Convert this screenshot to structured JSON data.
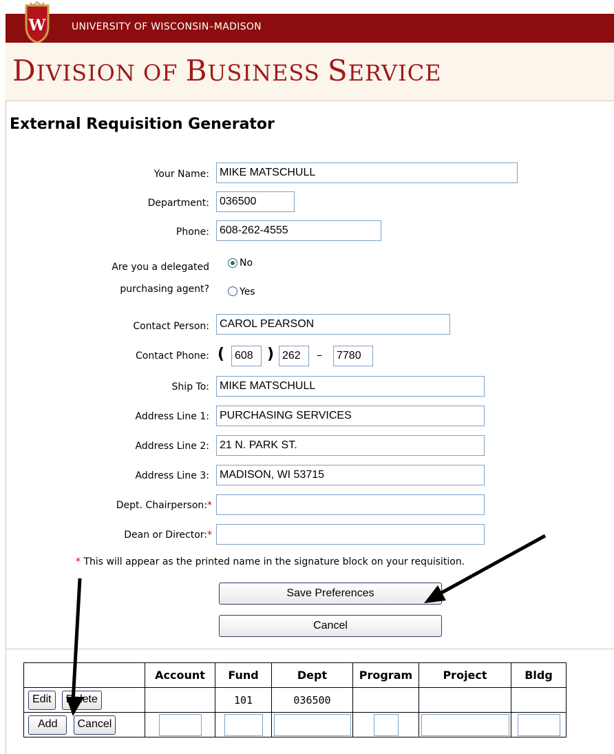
{
  "header": {
    "university": "UNIVERSITY OF WISCONSIN–MADISON",
    "division_first": "D",
    "division_rest": "IVISION OF ",
    "division_b": "B",
    "division_usiness": "USINESS ",
    "division_s": "S",
    "division_ervice": "ERVICE",
    "crest_letter": "W",
    "bar_color": "#8c0d0d",
    "title_color": "#a01919"
  },
  "page": {
    "title": "External Requisition Generator"
  },
  "form": {
    "your_name_label": "Your Name:",
    "your_name_value": "MIKE MATSCHULL",
    "department_label": "Department:",
    "department_value": "036500",
    "phone_label": "Phone:",
    "phone_value": "608-262-4555",
    "delegated_label_1": "Are you a delegated",
    "delegated_label_2": "purchasing agent?",
    "delegated_no": "No",
    "delegated_yes": "Yes",
    "delegated_selected": "No",
    "contact_person_label": "Contact Person:",
    "contact_person_value": "CAROL PEARSON",
    "contact_phone_label": "Contact Phone:",
    "contact_phone_open": "(",
    "contact_phone_close": ")",
    "contact_phone_dash": "–",
    "contact_phone_area": "608",
    "contact_phone_prefix": "262",
    "contact_phone_line": "7780",
    "ship_to_label": "Ship To:",
    "ship_to_value": "MIKE MATSCHULL",
    "address1_label": "Address Line 1:",
    "address1_value": "PURCHASING SERVICES",
    "address2_label": "Address Line 2:",
    "address2_value": "21 N. PARK ST.",
    "address3_label": "Address Line 3:",
    "address3_value": "MADISON, WI 53715",
    "chair_label": "Dept. Chairperson:",
    "chair_value": "",
    "dean_label": "Dean or Director:",
    "dean_value": "",
    "required_mark": "*",
    "note_text": " This will appear as the printed name in the signature block on your requisition.",
    "save_label": "Save Preferences",
    "cancel_label": "Cancel"
  },
  "funding_table": {
    "headers": [
      "",
      "Account",
      "Fund",
      "Dept",
      "Program",
      "Project",
      "Bldg"
    ],
    "row1": {
      "edit": "Edit",
      "delete": "Delete",
      "account": "",
      "fund": "101",
      "dept": "036500",
      "program": "",
      "project": "",
      "bldg": ""
    },
    "row2": {
      "add": "Add",
      "cancel": "Cancel"
    }
  }
}
